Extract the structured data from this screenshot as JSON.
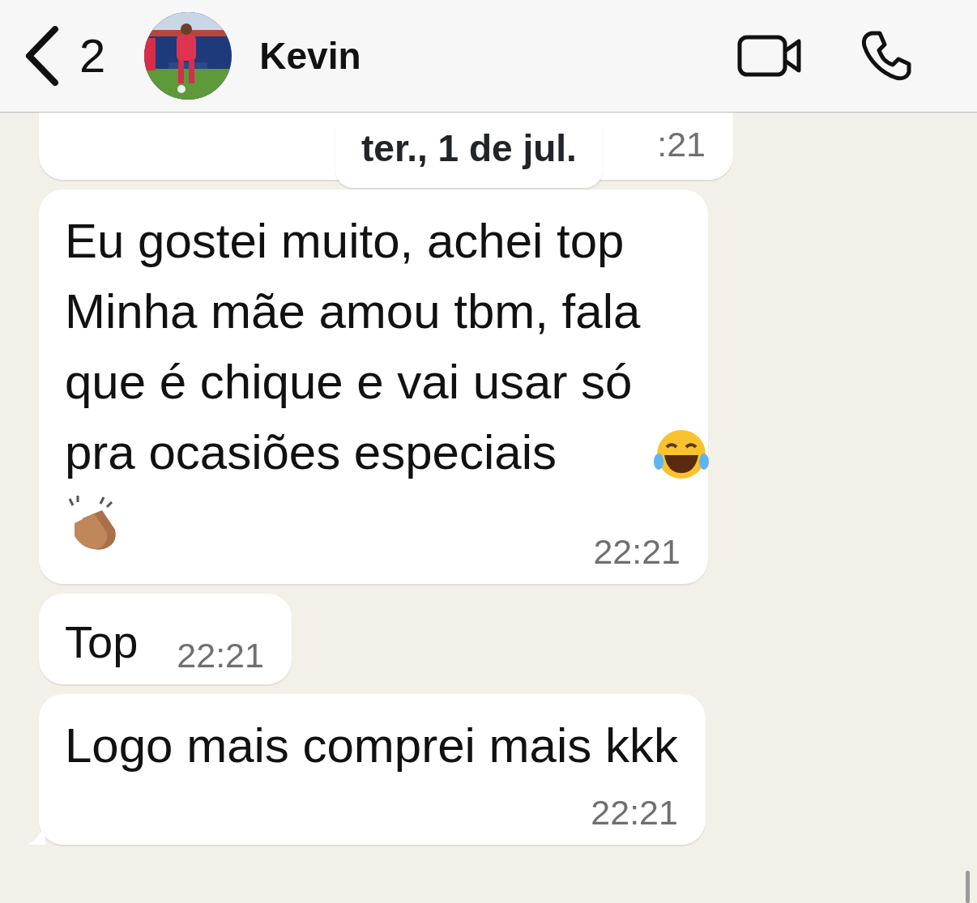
{
  "header": {
    "back_count": "2",
    "contact_name": "Kevin"
  },
  "date_pill": "ter., 1 de jul.",
  "messages": [
    {
      "kind": "partial",
      "time": ":21"
    },
    {
      "kind": "full",
      "text": "Eu gostei muito, achei top\nMinha mãe amou tbm, fala que é chique e vai usar só pra ocasiões especiais",
      "emojis": [
        {
          "kind": "tears-of-joy"
        },
        {
          "kind": "clapping"
        }
      ],
      "time": "22:21"
    },
    {
      "kind": "inline",
      "text": "Top",
      "time": "22:21"
    },
    {
      "kind": "full",
      "text": "Logo mais comprei mais kkk",
      "time": "22:21",
      "tail": true
    }
  ]
}
